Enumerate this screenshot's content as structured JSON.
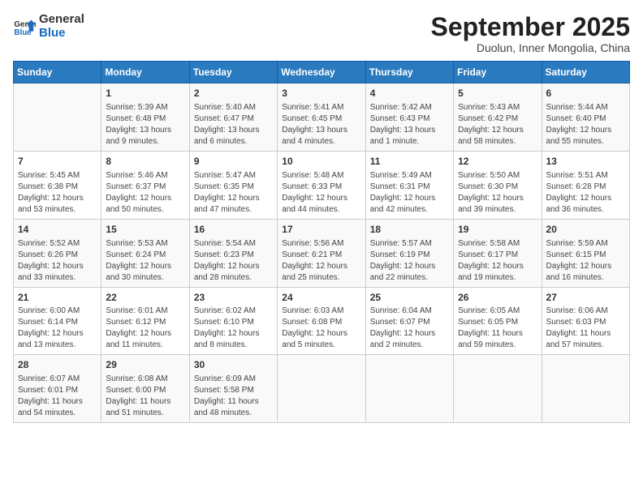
{
  "logo": {
    "text_general": "General",
    "text_blue": "Blue"
  },
  "title": "September 2025",
  "subtitle": "Duolun, Inner Mongolia, China",
  "days_of_week": [
    "Sunday",
    "Monday",
    "Tuesday",
    "Wednesday",
    "Thursday",
    "Friday",
    "Saturday"
  ],
  "weeks": [
    [
      {
        "day": "",
        "info": ""
      },
      {
        "day": "1",
        "info": "Sunrise: 5:39 AM\nSunset: 6:48 PM\nDaylight: 13 hours\nand 9 minutes."
      },
      {
        "day": "2",
        "info": "Sunrise: 5:40 AM\nSunset: 6:47 PM\nDaylight: 13 hours\nand 6 minutes."
      },
      {
        "day": "3",
        "info": "Sunrise: 5:41 AM\nSunset: 6:45 PM\nDaylight: 13 hours\nand 4 minutes."
      },
      {
        "day": "4",
        "info": "Sunrise: 5:42 AM\nSunset: 6:43 PM\nDaylight: 13 hours\nand 1 minute."
      },
      {
        "day": "5",
        "info": "Sunrise: 5:43 AM\nSunset: 6:42 PM\nDaylight: 12 hours\nand 58 minutes."
      },
      {
        "day": "6",
        "info": "Sunrise: 5:44 AM\nSunset: 6:40 PM\nDaylight: 12 hours\nand 55 minutes."
      }
    ],
    [
      {
        "day": "7",
        "info": "Sunrise: 5:45 AM\nSunset: 6:38 PM\nDaylight: 12 hours\nand 53 minutes."
      },
      {
        "day": "8",
        "info": "Sunrise: 5:46 AM\nSunset: 6:37 PM\nDaylight: 12 hours\nand 50 minutes."
      },
      {
        "day": "9",
        "info": "Sunrise: 5:47 AM\nSunset: 6:35 PM\nDaylight: 12 hours\nand 47 minutes."
      },
      {
        "day": "10",
        "info": "Sunrise: 5:48 AM\nSunset: 6:33 PM\nDaylight: 12 hours\nand 44 minutes."
      },
      {
        "day": "11",
        "info": "Sunrise: 5:49 AM\nSunset: 6:31 PM\nDaylight: 12 hours\nand 42 minutes."
      },
      {
        "day": "12",
        "info": "Sunrise: 5:50 AM\nSunset: 6:30 PM\nDaylight: 12 hours\nand 39 minutes."
      },
      {
        "day": "13",
        "info": "Sunrise: 5:51 AM\nSunset: 6:28 PM\nDaylight: 12 hours\nand 36 minutes."
      }
    ],
    [
      {
        "day": "14",
        "info": "Sunrise: 5:52 AM\nSunset: 6:26 PM\nDaylight: 12 hours\nand 33 minutes."
      },
      {
        "day": "15",
        "info": "Sunrise: 5:53 AM\nSunset: 6:24 PM\nDaylight: 12 hours\nand 30 minutes."
      },
      {
        "day": "16",
        "info": "Sunrise: 5:54 AM\nSunset: 6:23 PM\nDaylight: 12 hours\nand 28 minutes."
      },
      {
        "day": "17",
        "info": "Sunrise: 5:56 AM\nSunset: 6:21 PM\nDaylight: 12 hours\nand 25 minutes."
      },
      {
        "day": "18",
        "info": "Sunrise: 5:57 AM\nSunset: 6:19 PM\nDaylight: 12 hours\nand 22 minutes."
      },
      {
        "day": "19",
        "info": "Sunrise: 5:58 AM\nSunset: 6:17 PM\nDaylight: 12 hours\nand 19 minutes."
      },
      {
        "day": "20",
        "info": "Sunrise: 5:59 AM\nSunset: 6:15 PM\nDaylight: 12 hours\nand 16 minutes."
      }
    ],
    [
      {
        "day": "21",
        "info": "Sunrise: 6:00 AM\nSunset: 6:14 PM\nDaylight: 12 hours\nand 13 minutes."
      },
      {
        "day": "22",
        "info": "Sunrise: 6:01 AM\nSunset: 6:12 PM\nDaylight: 12 hours\nand 11 minutes."
      },
      {
        "day": "23",
        "info": "Sunrise: 6:02 AM\nSunset: 6:10 PM\nDaylight: 12 hours\nand 8 minutes."
      },
      {
        "day": "24",
        "info": "Sunrise: 6:03 AM\nSunset: 6:08 PM\nDaylight: 12 hours\nand 5 minutes."
      },
      {
        "day": "25",
        "info": "Sunrise: 6:04 AM\nSunset: 6:07 PM\nDaylight: 12 hours\nand 2 minutes."
      },
      {
        "day": "26",
        "info": "Sunrise: 6:05 AM\nSunset: 6:05 PM\nDaylight: 11 hours\nand 59 minutes."
      },
      {
        "day": "27",
        "info": "Sunrise: 6:06 AM\nSunset: 6:03 PM\nDaylight: 11 hours\nand 57 minutes."
      }
    ],
    [
      {
        "day": "28",
        "info": "Sunrise: 6:07 AM\nSunset: 6:01 PM\nDaylight: 11 hours\nand 54 minutes."
      },
      {
        "day": "29",
        "info": "Sunrise: 6:08 AM\nSunset: 6:00 PM\nDaylight: 11 hours\nand 51 minutes."
      },
      {
        "day": "30",
        "info": "Sunrise: 6:09 AM\nSunset: 5:58 PM\nDaylight: 11 hours\nand 48 minutes."
      },
      {
        "day": "",
        "info": ""
      },
      {
        "day": "",
        "info": ""
      },
      {
        "day": "",
        "info": ""
      },
      {
        "day": "",
        "info": ""
      }
    ]
  ]
}
